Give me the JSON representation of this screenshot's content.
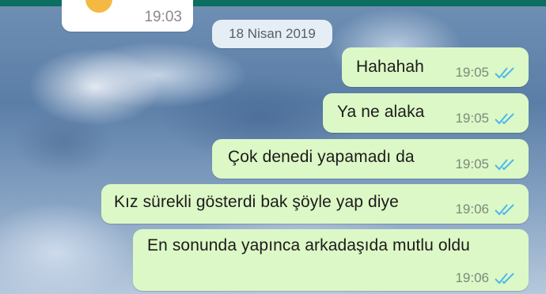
{
  "chat": {
    "previous_message": {
      "time": "19:03"
    },
    "date_divider": "18 Nisan 2019",
    "messages": [
      {
        "text": "Hahahah",
        "time": "19:05",
        "status": "read"
      },
      {
        "text": "Ya ne alaka",
        "time": "19:05",
        "status": "read"
      },
      {
        "text": "Çok denedi yapamadı da",
        "time": "19:05",
        "status": "read"
      },
      {
        "text": "Kız sürekli gösterdi bak şöyle yap diye",
        "time": "19:06",
        "status": "read"
      },
      {
        "text": "En sonunda yapınca arkadaşıda mutlu oldu",
        "time": "19:06",
        "status": "read"
      }
    ]
  },
  "colors": {
    "outgoing_bubble": "#dcf8c6",
    "read_ticks": "#4fb6ec",
    "date_chip": "#e6eef5",
    "header": "#0b6e5f"
  },
  "icons": {
    "status": "double-check-icon",
    "emoji": "emoji-icon"
  }
}
